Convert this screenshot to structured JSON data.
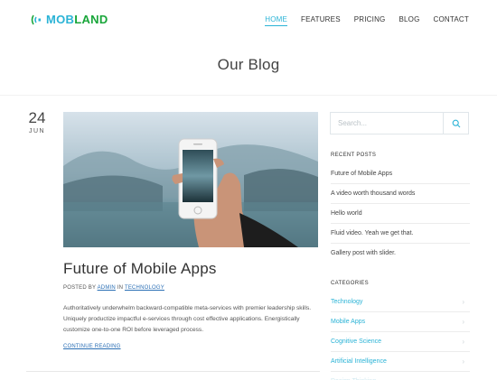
{
  "header": {
    "logo_part1": "MOB",
    "logo_part2": "LAND",
    "nav": [
      "HOME",
      "FEATURES",
      "PRICING",
      "BLOG",
      "CONTACT"
    ]
  },
  "page": {
    "title": "Our Blog"
  },
  "post": {
    "day": "24",
    "month": "JUN",
    "title": "Future of Mobile Apps",
    "meta_prefix": "POSTED BY ",
    "author": "ADMIN",
    "meta_in": " IN ",
    "category": "TECHNOLOGY",
    "excerpt": "Authoritatively underwhelm backward-compatible meta-services with premier leadership skills. Uniquely productize impactful e-services through cost effective applications. Energistically customize one-to-one ROI before leveraged process.",
    "read_more": "CONTINUE READING"
  },
  "sidebar": {
    "search_placeholder": "Search...",
    "recent_title": "RECENT POSTS",
    "recent_posts": [
      "Future of Mobile Apps",
      "A video worth thousand words",
      "Hello world",
      "Fluid video. Yeah we get that.",
      "Gallery post with slider."
    ],
    "categories_title": "CATEGORIES",
    "categories": [
      "Technology",
      "Mobile Apps",
      "Cognitive Science",
      "Artificial Intelligence",
      "Design Thinking"
    ]
  },
  "colors": {
    "accent": "#2ab3d6",
    "brand_green": "#19a63a",
    "link": "#2b6fb5"
  },
  "icons": {
    "logo": "signal-waves-icon",
    "search": "search-icon",
    "chevron": "chevron-right-icon"
  }
}
